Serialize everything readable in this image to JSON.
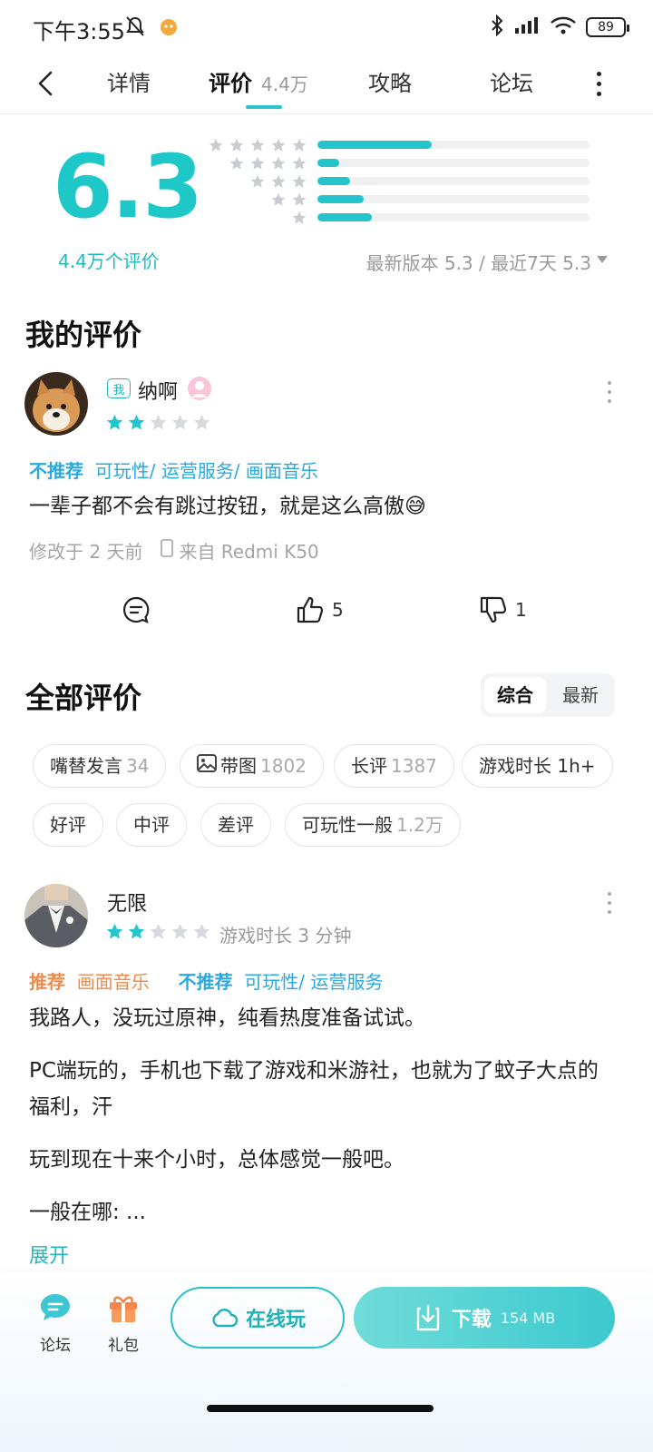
{
  "status_bar": {
    "time": "下午3:55",
    "battery": "89"
  },
  "nav": {
    "tabs": [
      {
        "label": "详情"
      },
      {
        "label": "评价",
        "count": "4.4万"
      },
      {
        "label": "攻略"
      },
      {
        "label": "论坛"
      }
    ]
  },
  "summary": {
    "score": "6.3",
    "count_label": "4.4万个评价",
    "version_info": "最新版本 5.3 / 最近7天 5.3",
    "distribution": [
      {
        "stars": 5,
        "fraction": 0.42
      },
      {
        "stars": 4,
        "fraction": 0.08
      },
      {
        "stars": 3,
        "fraction": 0.12
      },
      {
        "stars": 2,
        "fraction": 0.17
      },
      {
        "stars": 1,
        "fraction": 0.2
      }
    ]
  },
  "my_review": {
    "title": "我的评价",
    "me_badge": "我",
    "username": "纳啊",
    "rating": 2,
    "not_recommend_label": "不推荐",
    "not_recommend_tags": "可玩性/ 运营服务/ 画面音乐",
    "text": "一辈子都不会有跳过按钮，就是这么高傲😅",
    "modified": "修改于 2 天前",
    "device": "来自 Redmi K50",
    "likes": "5",
    "dislikes": "1"
  },
  "all_reviews": {
    "title": "全部评价",
    "sort_options": [
      "综合",
      "最新"
    ],
    "filters": [
      {
        "label": "嘴替发言",
        "count": "34"
      },
      {
        "label": "带图",
        "count": "1802"
      },
      {
        "label": "长评",
        "count": "1387"
      },
      {
        "label": "游戏时长 1h+",
        "count": ""
      },
      {
        "label": "好评",
        "count": ""
      },
      {
        "label": "中评",
        "count": ""
      },
      {
        "label": "差评",
        "count": ""
      },
      {
        "label": "可玩性一般",
        "count": "1.2万"
      }
    ]
  },
  "review": {
    "username": "无限",
    "rating": 2,
    "playtime": "游戏时长 3 分钟",
    "recommend_label": "推荐",
    "recommend_tags": "画面音乐",
    "not_recommend_label": "不推荐",
    "not_recommend_tags": "可玩性/ 运营服务",
    "paragraphs": [
      "我路人，没玩过原神，纯看热度准备试试。",
      "PC端玩的，手机也下载了游戏和米游社，也就为了蚊子大点的福利，汗",
      "玩到现在十来个小时，总体感觉一般吧。",
      "一般在哪: ..."
    ],
    "expand_label": "展开"
  },
  "bottom_bar": {
    "forum_label": "论坛",
    "gift_label": "礼包",
    "online_label": "在线玩",
    "download_label": "下载",
    "download_size": "154 MB"
  },
  "colors": {
    "accent": "#22c5cb",
    "negative_tag": "#2aa8e0",
    "positive_tag": "#f08a4b"
  }
}
